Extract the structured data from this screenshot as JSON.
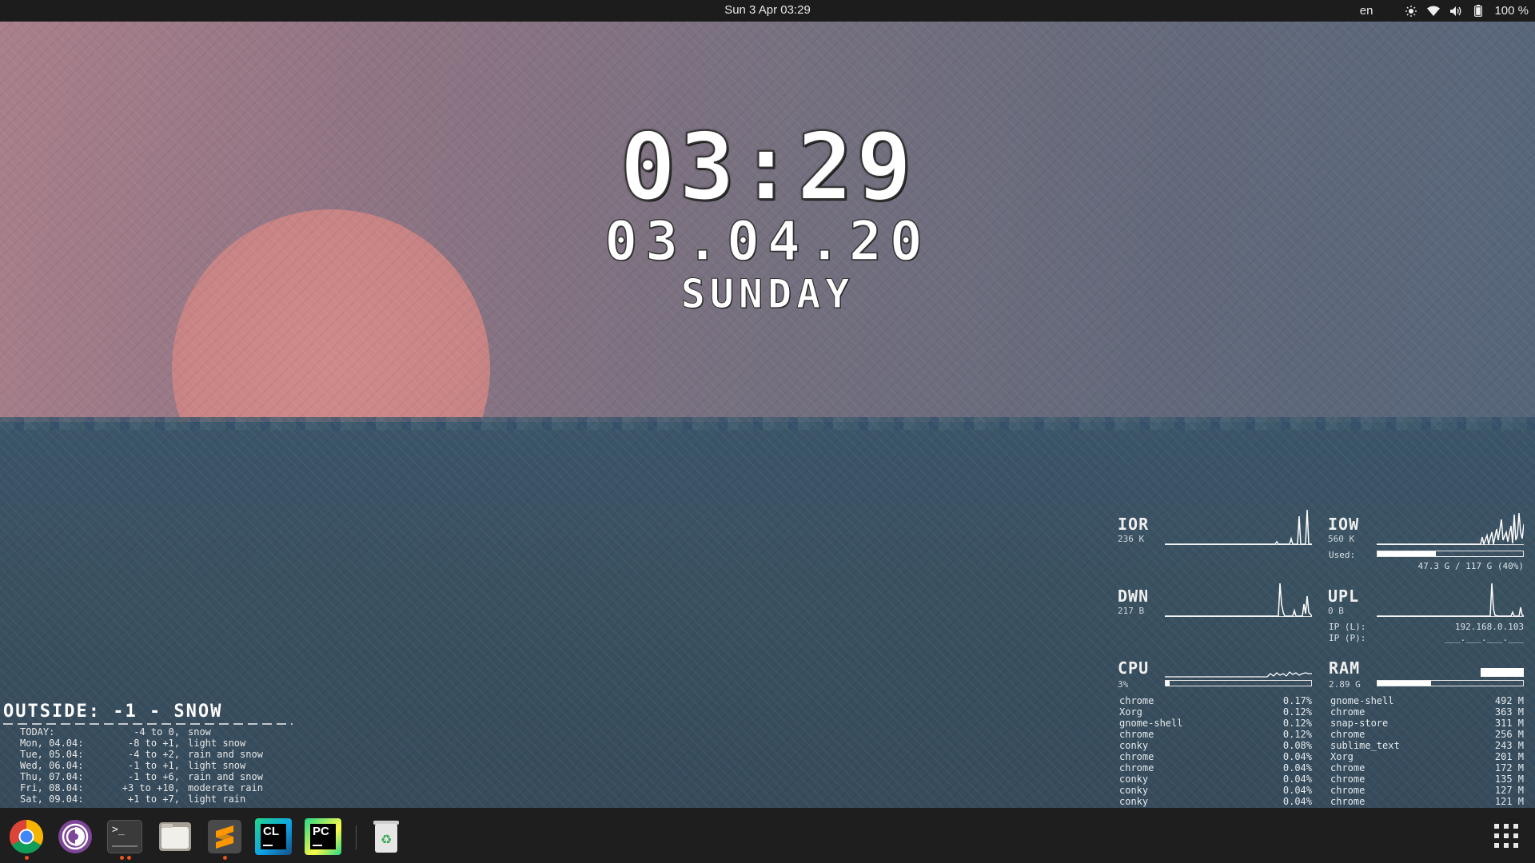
{
  "topbar": {
    "datetime": "Sun 3 Apr  03:29",
    "language": "en",
    "battery": "100 %",
    "icons": [
      "brightness-icon",
      "wifi-icon",
      "volume-icon",
      "battery-icon"
    ]
  },
  "clock": {
    "time": "03:29",
    "date": "03.04.20",
    "day": "SUNDAY"
  },
  "weather": {
    "header": "OUTSIDE: -1 - SNOW",
    "forecast": [
      {
        "day": "TODAY:",
        "range": "-4 to 0,",
        "cond": "snow"
      },
      {
        "day": "Mon, 04.04:",
        "range": "-8 to +1,",
        "cond": "light snow"
      },
      {
        "day": "Tue, 05.04:",
        "range": "-4 to +2,",
        "cond": "rain and snow"
      },
      {
        "day": "Wed, 06.04:",
        "range": "-1 to +1,",
        "cond": "light snow"
      },
      {
        "day": "Thu, 07.04:",
        "range": "-1 to +6,",
        "cond": "rain and snow"
      },
      {
        "day": "Fri, 08.04:",
        "range": "+3 to +10,",
        "cond": "moderate rain"
      },
      {
        "day": "Sat, 09.04:",
        "range": "+1 to +7,",
        "cond": "light rain"
      }
    ]
  },
  "conky": {
    "ior": {
      "label": "IOR",
      "value": "236 K"
    },
    "iow": {
      "label": "IOW",
      "value": "560 K"
    },
    "disk": {
      "label": "Used:",
      "text": "47.3 G / 117 G (40%)",
      "fraction": 0.4
    },
    "dwn": {
      "label": "DWN",
      "value": "217 B"
    },
    "upl": {
      "label": "UPL",
      "value": "0 B"
    },
    "ip": {
      "local_label": "IP (L):",
      "local": "192.168.0.103",
      "public_label": "IP (P):",
      "public": "___.___.___.___"
    },
    "cpu": {
      "label": "CPU",
      "value": "3%",
      "fraction": 0.03
    },
    "ram": {
      "label": "RAM",
      "value": "2.89 G",
      "fraction": 0.37
    },
    "cpu_procs": [
      {
        "name": "chrome",
        "val": "0.17%"
      },
      {
        "name": "Xorg",
        "val": "0.12%"
      },
      {
        "name": "gnome-shell",
        "val": "0.12%"
      },
      {
        "name": "chrome",
        "val": "0.12%"
      },
      {
        "name": "conky",
        "val": "0.08%"
      },
      {
        "name": "chrome",
        "val": "0.04%"
      },
      {
        "name": "chrome",
        "val": "0.04%"
      },
      {
        "name": "conky",
        "val": "0.04%"
      },
      {
        "name": "conky",
        "val": "0.04%"
      },
      {
        "name": "conky",
        "val": "0.04%"
      }
    ],
    "ram_procs": [
      {
        "name": "gnome-shell",
        "val": "492 M"
      },
      {
        "name": "chrome",
        "val": "363 M"
      },
      {
        "name": "snap-store",
        "val": "311 M"
      },
      {
        "name": "chrome",
        "val": "256 M"
      },
      {
        "name": "sublime_text",
        "val": "243 M"
      },
      {
        "name": "Xorg",
        "val": "201 M"
      },
      {
        "name": "chrome",
        "val": "172 M"
      },
      {
        "name": "chrome",
        "val": "135 M"
      },
      {
        "name": "chrome",
        "val": "127 M"
      },
      {
        "name": "chrome",
        "val": "121 M"
      }
    ]
  },
  "dock": {
    "apps": [
      {
        "name": "chrome",
        "label": "",
        "running": true
      },
      {
        "name": "tor-browser",
        "label": "",
        "running": false
      },
      {
        "name": "terminal",
        "label": ">_",
        "running": true
      },
      {
        "name": "files",
        "label": "",
        "running": false
      },
      {
        "name": "sublime-text",
        "label": "",
        "running": true
      },
      {
        "name": "clion",
        "label": "CL",
        "running": false
      },
      {
        "name": "pycharm",
        "label": "PC",
        "running": false
      },
      {
        "name": "trash",
        "label": "",
        "running": false
      }
    ]
  },
  "colors": {
    "accent": "#e95420",
    "bar_bg": "#1c1c1c"
  }
}
